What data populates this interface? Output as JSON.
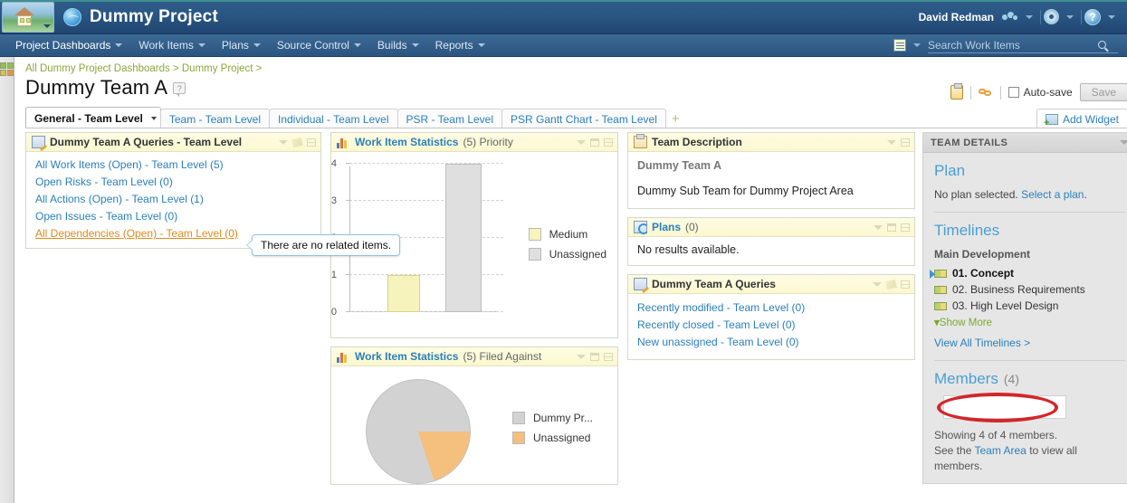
{
  "banner": {
    "home_tooltip": "Home",
    "project_title": "Dummy Project",
    "user_name": "David Redman"
  },
  "nav": {
    "items": [
      {
        "label": "Project Dashboards",
        "has_caret": true,
        "active": true
      },
      {
        "label": "Work Items",
        "has_caret": true,
        "active": false
      },
      {
        "label": "Plans",
        "has_caret": true,
        "active": false
      },
      {
        "label": "Source Control",
        "has_caret": true,
        "active": false
      },
      {
        "label": "Builds",
        "has_caret": true,
        "active": false
      },
      {
        "label": "Reports",
        "has_caret": true,
        "active": false
      }
    ],
    "search_placeholder": "Search Work Items",
    "search_value": ""
  },
  "page": {
    "breadcrumb": "All Dummy Project Dashboards > Dummy Project >",
    "title": "Dummy Team A",
    "autosave_label": "Auto-save",
    "autosave_checked": false,
    "save_label": "Save",
    "add_widget_label": "Add Widget"
  },
  "tabs": {
    "items": [
      {
        "label": "General - Team Level",
        "active": true
      },
      {
        "label": "Team - Team Level",
        "active": false
      },
      {
        "label": "Individual - Team Level",
        "active": false
      },
      {
        "label": "PSR - Team Level",
        "active": false
      },
      {
        "label": "PSR Gantt Chart - Team Level",
        "active": false
      }
    ],
    "add_tab_glyph": "+"
  },
  "tooltip": {
    "text": "There are no related items."
  },
  "widgets": {
    "team_queries": {
      "title": "Dummy Team A Queries - Team Level",
      "links": [
        {
          "label": "All Work Items (Open) - Team Level (5)",
          "highlighted": false
        },
        {
          "label": "Open Risks - Team Level (0)",
          "highlighted": false
        },
        {
          "label": "All Actions (Open) - Team Level (1)",
          "highlighted": false
        },
        {
          "label": "Open Issues - Team Level (0)",
          "highlighted": false
        },
        {
          "label": "All Dependencies (Open) - Team Level (0)",
          "highlighted": true
        }
      ]
    },
    "stats_priority": {
      "title": "Work Item Statistics",
      "subtitle": "(5) Priority"
    },
    "stats_filed": {
      "title": "Work Item Statistics",
      "subtitle": "(5) Filed Against"
    },
    "team_description": {
      "title": "Team Description",
      "team_name": "Dummy Team A",
      "description": "Dummy Sub Team for Dummy Project Area"
    },
    "plans": {
      "title": "Plans",
      "count": "(0)",
      "empty_text": "No results available."
    },
    "queries2": {
      "title": "Dummy Team A Queries",
      "links": [
        {
          "label": "Recently modified - Team Level (0)"
        },
        {
          "label": "Recently closed - Team Level (0)"
        },
        {
          "label": "New unassigned - Team Level (0)"
        }
      ]
    }
  },
  "team_details": {
    "panel_title": "TEAM DETAILS",
    "plan_heading": "Plan",
    "plan_text": "No plan selected.",
    "plan_link": "Select a plan",
    "plan_text_end": ".",
    "timelines_heading": "Timelines",
    "timeline_group": "Main Development",
    "timeline_items": [
      {
        "label": "01. Concept",
        "current": true
      },
      {
        "label": "02. Business Requirements",
        "current": false
      },
      {
        "label": "03. High Level Design",
        "current": false
      }
    ],
    "show_more": "Show More",
    "show_more_glyph": "»",
    "view_all": "View All Timelines >",
    "members_heading": "Members",
    "members_count": "(4)",
    "members_note": "Showing 4 of 4 members.",
    "members_note2_pre": "See the ",
    "members_note2_link": "Team Area",
    "members_note2_post": " to view all members."
  },
  "chart_data": [
    {
      "type": "bar",
      "title": "Work Item Statistics (5) Priority",
      "categories": [
        "Medium",
        "Unassigned"
      ],
      "values": [
        1,
        4
      ],
      "colors": [
        "#f7f3bd",
        "#dfdfdf"
      ],
      "xlabel": "",
      "ylabel": "",
      "ylim": [
        0,
        4
      ],
      "yticks": [
        0,
        1,
        2,
        3,
        4
      ],
      "grid": true,
      "legend_position": "right",
      "legend": [
        "Medium",
        "Unassigned"
      ]
    },
    {
      "type": "pie",
      "title": "Work Item Statistics (5) Filed Against",
      "labels": [
        "Dummy Pr...",
        "Unassigned"
      ],
      "values": [
        4,
        1
      ],
      "percentages": [
        80,
        20
      ],
      "colors": [
        "#d2d2d2",
        "#f5bf7e"
      ],
      "legend_position": "right"
    }
  ]
}
